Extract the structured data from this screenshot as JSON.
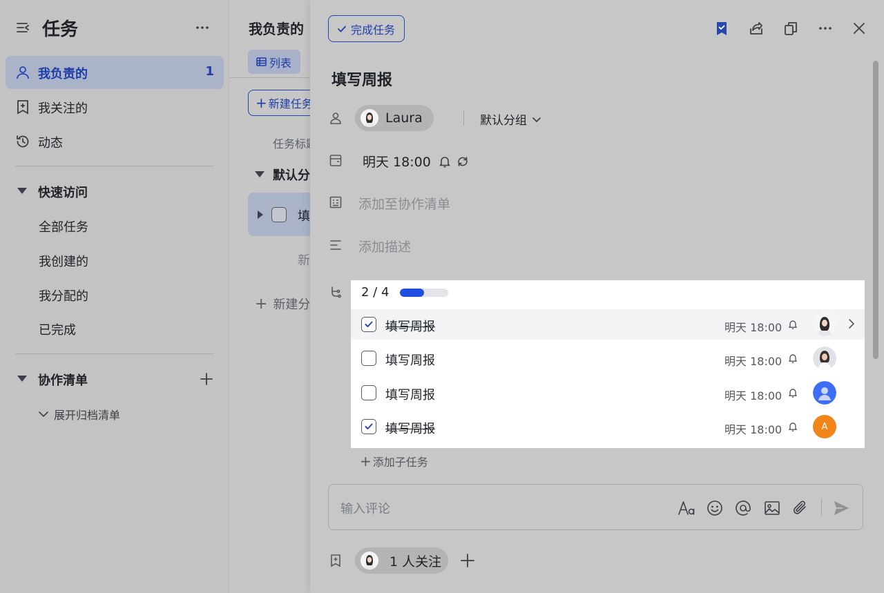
{
  "sidebar": {
    "title": "任务",
    "items": [
      {
        "label": "我负责的",
        "count": "1"
      },
      {
        "label": "我关注的"
      },
      {
        "label": "动态"
      }
    ],
    "quick_access": {
      "label": "快速访问",
      "items": [
        "全部任务",
        "我创建的",
        "我分配的",
        "已完成"
      ]
    },
    "collab": {
      "label": "协作清单",
      "archive_label": "展开归档清单"
    }
  },
  "middle": {
    "title": "我负责的",
    "tab_label": "列表",
    "new_task_label": "新建任务",
    "column_header": "任务标题",
    "group_label": "默认分组",
    "row_label": "填写周报",
    "new_task_inline": "新建任务",
    "new_group_label": "新建分组"
  },
  "detail": {
    "complete_label": "完成任务",
    "title": "填写周报",
    "assignee": "Laura",
    "group": "默认分组",
    "due": "明天 18:00",
    "add_to_list": "添加至协作清单",
    "add_desc": "添加描述",
    "progress": {
      "text": "2 / 4",
      "done": 2,
      "total": 4
    },
    "subtasks": [
      {
        "label": "填写周报",
        "done": true,
        "due": "明天 18:00",
        "avatar": "photo"
      },
      {
        "label": "填写周报",
        "done": false,
        "due": "明天 18:00",
        "avatar": "photo2"
      },
      {
        "label": "填写周报",
        "done": false,
        "due": "明天 18:00",
        "avatar": "blue-person"
      },
      {
        "label": "填写周报",
        "done": true,
        "due": "明天 18:00",
        "avatar": "orange-letter",
        "avatar_letter": "A"
      }
    ],
    "add_subtask": "添加子任务",
    "comment_placeholder": "输入评论",
    "followers": "1 人关注"
  },
  "colors": {
    "accent": "#2446ad",
    "progress": "#1f4fe0",
    "avatar_blue": "#3e6ef5",
    "avatar_orange": "#f2851a"
  }
}
